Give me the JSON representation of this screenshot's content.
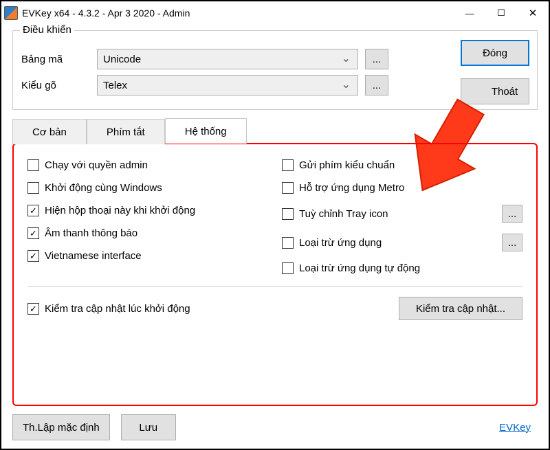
{
  "window": {
    "title": "EVKey x64 - 4.3.2 - Apr  3 2020 - Admin"
  },
  "group": {
    "legend": "Điều khiển",
    "encoding_label": "Bảng mã",
    "encoding_value": "Unicode",
    "input_label": "Kiểu gõ",
    "input_value": "Telex",
    "dots": "..."
  },
  "side": {
    "close": "Đóng",
    "exit": "Thoát"
  },
  "tabs": {
    "basic": "Cơ bản",
    "hotkey": "Phím tắt",
    "system": "Hệ thống"
  },
  "checks": {
    "run_admin": "Chạy với quyền admin",
    "start_windows": "Khởi động cùng Windows",
    "show_dialog": "Hiện hộp thoại này khi khởi động",
    "sound": "Âm thanh thông báo",
    "vi_interface": "Vietnamese interface",
    "send_std": "Gửi phím kiểu chuẩn",
    "metro": "Hỗ trợ ứng dụng Metro",
    "tray": "Tuỳ chỉnh Tray icon",
    "exclude": "Loại trừ ứng dụng",
    "exclude_auto": "Loại trừ ứng dụng tự động",
    "check_update_start": "Kiểm tra cập nhật lúc khởi động",
    "check_update_btn": "Kiểm tra cập nhật..."
  },
  "footer": {
    "defaults": "Th.Lập mặc định",
    "save": "Lưu",
    "link": "EVKey"
  },
  "misc": {
    "dots": "..."
  }
}
